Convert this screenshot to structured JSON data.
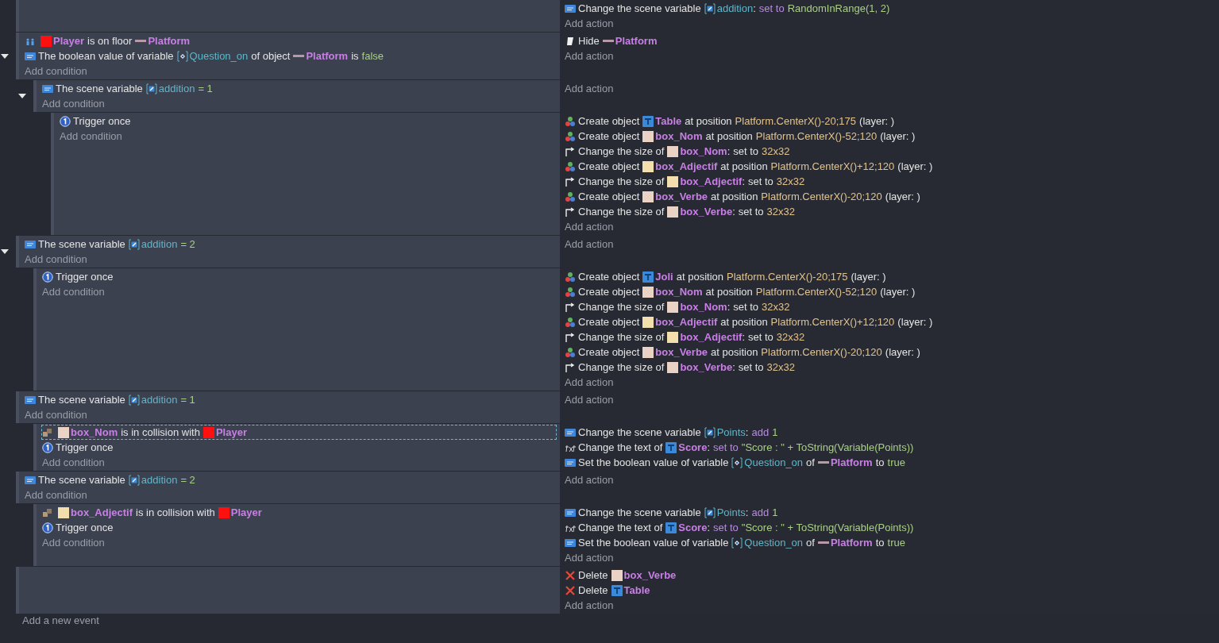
{
  "events": [
    {
      "actions": [
        {
          "kind": "variable",
          "parts": [
            {
              "text": "Change the scene variable",
              "kind": "plain"
            },
            {
              "text": "addition",
              "kind": "scene_variable"
            },
            {
              "text": ":",
              "kind": "suffix"
            },
            {
              "text": "set to",
              "kind": "keyword"
            },
            {
              "text": "RandomInRange(1, 2)",
              "kind": "number"
            }
          ]
        }
      ],
      "add_action": "Add action"
    },
    {
      "expanded": true,
      "conditions": [
        {
          "selected": false,
          "kind": "platformer",
          "parts": [
            {
              "text": "Player",
              "kind": "sprite",
              "color": "#ff1010"
            },
            {
              "text": "is on floor",
              "kind": "plain"
            },
            {
              "text": "Platform",
              "kind": "platform_object"
            }
          ]
        },
        {
          "selected": false,
          "kind": "variable",
          "parts": [
            {
              "text": "The boolean value of variable",
              "kind": "plain"
            },
            {
              "text": "Question_on",
              "kind": "object_variable"
            },
            {
              "text": "of object",
              "kind": "plain"
            },
            {
              "text": "Platform",
              "kind": "platform_object"
            },
            {
              "text": "is",
              "kind": "plain"
            },
            {
              "text": "false",
              "kind": "number"
            }
          ]
        }
      ],
      "add_condition": "Add condition",
      "actions": [
        {
          "kind": "hide",
          "parts": [
            {
              "text": "Hide",
              "kind": "plain"
            },
            {
              "text": "Platform",
              "kind": "platform_object"
            }
          ]
        }
      ],
      "add_action": "Add action",
      "children": [
        {
          "expanded": true,
          "conditions": [
            {
              "selected": false,
              "kind": "variable",
              "parts": [
                {
                  "text": "The scene variable",
                  "kind": "plain"
                },
                {
                  "text": "addition",
                  "kind": "scene_variable"
                },
                {
                  "text": "= 1",
                  "kind": "number"
                }
              ]
            }
          ],
          "add_condition": "Add condition",
          "add_action": "Add action",
          "children": [
            {
              "conditions": [
                {
                  "selected": false,
                  "kind": "trigger",
                  "parts": [
                    {
                      "text": "Trigger once",
                      "kind": "plain"
                    }
                  ]
                }
              ],
              "add_condition": "Add condition",
              "actions": [
                {
                  "kind": "create",
                  "parts": [
                    {
                      "text": "Create object",
                      "kind": "plain"
                    },
                    {
                      "text": "Table",
                      "kind": "text_object"
                    },
                    {
                      "text": "at position",
                      "kind": "plain"
                    },
                    {
                      "text": "Platform.CenterX()-20;175",
                      "kind": "expression"
                    },
                    {
                      "text": "(layer: )",
                      "kind": "plain"
                    }
                  ]
                },
                {
                  "kind": "create",
                  "parts": [
                    {
                      "text": "Create object",
                      "kind": "plain"
                    },
                    {
                      "text": "box_Nom",
                      "kind": "sprite",
                      "color": "#ead2c4"
                    },
                    {
                      "text": "at position",
                      "kind": "plain"
                    },
                    {
                      "text": "Platform.CenterX()-52;120",
                      "kind": "expression"
                    },
                    {
                      "text": "(layer: )",
                      "kind": "plain"
                    }
                  ]
                },
                {
                  "kind": "resize",
                  "parts": [
                    {
                      "text": "Change the size of",
                      "kind": "plain"
                    },
                    {
                      "text": "box_Nom",
                      "kind": "sprite",
                      "color": "#ead2c4"
                    },
                    {
                      "text": ":",
                      "kind": "suffix"
                    },
                    {
                      "text": "set to",
                      "kind": "plain"
                    },
                    {
                      "text": "32x32",
                      "kind": "expression"
                    }
                  ]
                },
                {
                  "kind": "create",
                  "parts": [
                    {
                      "text": "Create object",
                      "kind": "plain"
                    },
                    {
                      "text": "box_Adjectif",
                      "kind": "sprite",
                      "color": "#f3dfae"
                    },
                    {
                      "text": "at position",
                      "kind": "plain"
                    },
                    {
                      "text": "Platform.CenterX()+12;120",
                      "kind": "expression"
                    },
                    {
                      "text": "(layer: )",
                      "kind": "plain"
                    }
                  ]
                },
                {
                  "kind": "resize",
                  "parts": [
                    {
                      "text": "Change the size of",
                      "kind": "plain"
                    },
                    {
                      "text": "box_Adjectif",
                      "kind": "sprite",
                      "color": "#f3dfae"
                    },
                    {
                      "text": ":",
                      "kind": "suffix"
                    },
                    {
                      "text": "set to",
                      "kind": "plain"
                    },
                    {
                      "text": "32x32",
                      "kind": "expression"
                    }
                  ]
                },
                {
                  "kind": "create",
                  "parts": [
                    {
                      "text": "Create object",
                      "kind": "plain"
                    },
                    {
                      "text": "box_Verbe",
                      "kind": "sprite",
                      "color": "#ead2c4"
                    },
                    {
                      "text": "at position",
                      "kind": "plain"
                    },
                    {
                      "text": "Platform.CenterX()-20;120",
                      "kind": "expression"
                    },
                    {
                      "text": "(layer: )",
                      "kind": "plain"
                    }
                  ]
                },
                {
                  "kind": "resize",
                  "parts": [
                    {
                      "text": "Change the size of",
                      "kind": "plain"
                    },
                    {
                      "text": "box_Verbe",
                      "kind": "sprite",
                      "color": "#ead2c4"
                    },
                    {
                      "text": ":",
                      "kind": "suffix"
                    },
                    {
                      "text": "set to",
                      "kind": "plain"
                    },
                    {
                      "text": "32x32",
                      "kind": "expression"
                    }
                  ]
                }
              ],
              "add_action": "Add action"
            }
          ]
        }
      ]
    },
    {
      "expanded": true,
      "conditions": [
        {
          "selected": false,
          "kind": "variable",
          "parts": [
            {
              "text": "The scene variable",
              "kind": "plain"
            },
            {
              "text": "addition",
              "kind": "scene_variable"
            },
            {
              "text": "= 2",
              "kind": "number"
            }
          ]
        }
      ],
      "add_condition": "Add condition",
      "add_action": "Add action",
      "children": [
        {
          "conditions": [
            {
              "selected": false,
              "kind": "trigger",
              "parts": [
                {
                  "text": "Trigger once",
                  "kind": "plain"
                }
              ]
            }
          ],
          "add_condition": "Add condition",
          "actions": [
            {
              "kind": "create",
              "parts": [
                {
                  "text": "Create object",
                  "kind": "plain"
                },
                {
                  "text": "Joli",
                  "kind": "text_object"
                },
                {
                  "text": "at position",
                  "kind": "plain"
                },
                {
                  "text": "Platform.CenterX()-20;175",
                  "kind": "expression"
                },
                {
                  "text": "(layer: )",
                  "kind": "plain"
                }
              ]
            },
            {
              "kind": "create",
              "parts": [
                {
                  "text": "Create object",
                  "kind": "plain"
                },
                {
                  "text": "box_Nom",
                  "kind": "sprite",
                  "color": "#ead2c4"
                },
                {
                  "text": "at position",
                  "kind": "plain"
                },
                {
                  "text": "Platform.CenterX()-52;120",
                  "kind": "expression"
                },
                {
                  "text": "(layer: )",
                  "kind": "plain"
                }
              ]
            },
            {
              "kind": "resize",
              "parts": [
                {
                  "text": "Change the size of",
                  "kind": "plain"
                },
                {
                  "text": "box_Nom",
                  "kind": "sprite",
                  "color": "#ead2c4"
                },
                {
                  "text": ":",
                  "kind": "suffix"
                },
                {
                  "text": "set to",
                  "kind": "plain"
                },
                {
                  "text": "32x32",
                  "kind": "expression"
                }
              ]
            },
            {
              "kind": "create",
              "parts": [
                {
                  "text": "Create object",
                  "kind": "plain"
                },
                {
                  "text": "box_Adjectif",
                  "kind": "sprite",
                  "color": "#f3dfae"
                },
                {
                  "text": "at position",
                  "kind": "plain"
                },
                {
                  "text": "Platform.CenterX()+12;120",
                  "kind": "expression"
                },
                {
                  "text": "(layer: )",
                  "kind": "plain"
                }
              ]
            },
            {
              "kind": "resize",
              "parts": [
                {
                  "text": "Change the size of",
                  "kind": "plain"
                },
                {
                  "text": "box_Adjectif",
                  "kind": "sprite",
                  "color": "#f3dfae"
                },
                {
                  "text": ":",
                  "kind": "suffix"
                },
                {
                  "text": "set to",
                  "kind": "plain"
                },
                {
                  "text": "32x32",
                  "kind": "expression"
                }
              ]
            },
            {
              "kind": "create",
              "parts": [
                {
                  "text": "Create object",
                  "kind": "plain"
                },
                {
                  "text": "box_Verbe",
                  "kind": "sprite",
                  "color": "#ead2c4"
                },
                {
                  "text": "at position",
                  "kind": "plain"
                },
                {
                  "text": "Platform.CenterX()-20;120",
                  "kind": "expression"
                },
                {
                  "text": "(layer: )",
                  "kind": "plain"
                }
              ]
            },
            {
              "kind": "resize",
              "parts": [
                {
                  "text": "Change the size of",
                  "kind": "plain"
                },
                {
                  "text": "box_Verbe",
                  "kind": "sprite",
                  "color": "#ead2c4"
                },
                {
                  "text": ":",
                  "kind": "suffix"
                },
                {
                  "text": "set to",
                  "kind": "plain"
                },
                {
                  "text": "32x32",
                  "kind": "expression"
                }
              ]
            }
          ],
          "add_action": "Add action"
        }
      ]
    },
    {
      "conditions": [
        {
          "selected": false,
          "kind": "variable",
          "parts": [
            {
              "text": "The scene variable",
              "kind": "plain"
            },
            {
              "text": "addition",
              "kind": "scene_variable"
            },
            {
              "text": "= 1",
              "kind": "number"
            }
          ]
        }
      ],
      "add_condition": "Add condition",
      "add_action": "Add action",
      "children": [
        {
          "conditions": [
            {
              "selected": true,
              "kind": "collision",
              "parts": [
                {
                  "text": "box_Nom",
                  "kind": "sprite",
                  "color": "#ead2c4"
                },
                {
                  "text": "is in collision with",
                  "kind": "plain"
                },
                {
                  "text": "Player",
                  "kind": "sprite",
                  "color": "#ff1010"
                }
              ]
            },
            {
              "selected": false,
              "kind": "trigger",
              "parts": [
                {
                  "text": "Trigger once",
                  "kind": "plain"
                }
              ]
            }
          ],
          "add_condition": "Add condition",
          "actions": [
            {
              "kind": "variable",
              "parts": [
                {
                  "text": "Change the scene variable",
                  "kind": "plain"
                },
                {
                  "text": "Points",
                  "kind": "scene_variable"
                },
                {
                  "text": ":",
                  "kind": "suffix"
                },
                {
                  "text": "add",
                  "kind": "keyword"
                },
                {
                  "text": "1",
                  "kind": "number"
                }
              ]
            },
            {
              "kind": "text",
              "parts": [
                {
                  "text": "Change the text of",
                  "kind": "plain"
                },
                {
                  "text": "Score",
                  "kind": "text_object"
                },
                {
                  "text": ":",
                  "kind": "suffix"
                },
                {
                  "text": "set to",
                  "kind": "keyword"
                },
                {
                  "text": "\"Score : \" + ToString(Variable(Points))",
                  "kind": "number"
                }
              ]
            },
            {
              "kind": "variable",
              "parts": [
                {
                  "text": "Set the boolean value of variable",
                  "kind": "plain"
                },
                {
                  "text": "Question_on",
                  "kind": "object_variable"
                },
                {
                  "text": "of",
                  "kind": "plain"
                },
                {
                  "text": "Platform",
                  "kind": "platform_object"
                },
                {
                  "text": "to",
                  "kind": "plain"
                },
                {
                  "text": "true",
                  "kind": "number"
                }
              ]
            }
          ]
        }
      ]
    },
    {
      "conditions": [
        {
          "selected": false,
          "kind": "variable",
          "parts": [
            {
              "text": "The scene variable",
              "kind": "plain"
            },
            {
              "text": "addition",
              "kind": "scene_variable"
            },
            {
              "text": "= 2",
              "kind": "number"
            }
          ]
        }
      ],
      "add_condition": "Add condition",
      "add_action": "Add action",
      "children": [
        {
          "conditions": [
            {
              "selected": false,
              "kind": "collision",
              "parts": [
                {
                  "text": "box_Adjectif",
                  "kind": "sprite",
                  "color": "#f3dfae"
                },
                {
                  "text": "is in collision with",
                  "kind": "plain"
                },
                {
                  "text": "Player",
                  "kind": "sprite",
                  "color": "#ff1010"
                }
              ]
            },
            {
              "selected": false,
              "kind": "trigger",
              "parts": [
                {
                  "text": "Trigger once",
                  "kind": "plain"
                }
              ]
            }
          ],
          "add_condition": "Add condition",
          "actions": [
            {
              "kind": "variable",
              "parts": [
                {
                  "text": "Change the scene variable",
                  "kind": "plain"
                },
                {
                  "text": "Points",
                  "kind": "scene_variable"
                },
                {
                  "text": ":",
                  "kind": "suffix"
                },
                {
                  "text": "add",
                  "kind": "keyword"
                },
                {
                  "text": "1",
                  "kind": "number"
                }
              ]
            },
            {
              "kind": "text",
              "parts": [
                {
                  "text": "Change the text of",
                  "kind": "plain"
                },
                {
                  "text": "Score",
                  "kind": "text_object"
                },
                {
                  "text": ":",
                  "kind": "suffix"
                },
                {
                  "text": "set to",
                  "kind": "keyword"
                },
                {
                  "text": "\"Score : \" + ToString(Variable(Points))",
                  "kind": "number"
                }
              ]
            },
            {
              "kind": "variable",
              "parts": [
                {
                  "text": "Set the boolean value of variable",
                  "kind": "plain"
                },
                {
                  "text": "Question_on",
                  "kind": "object_variable"
                },
                {
                  "text": "of",
                  "kind": "plain"
                },
                {
                  "text": "Platform",
                  "kind": "platform_object"
                },
                {
                  "text": "to",
                  "kind": "plain"
                },
                {
                  "text": "true",
                  "kind": "number"
                }
              ]
            }
          ],
          "add_action": "Add action"
        }
      ]
    },
    {
      "actions": [
        {
          "kind": "delete",
          "parts": [
            {
              "text": "Delete",
              "kind": "plain"
            },
            {
              "text": "box_Verbe",
              "kind": "sprite",
              "color": "#ead2c4"
            }
          ]
        },
        {
          "kind": "delete",
          "parts": [
            {
              "text": "Delete",
              "kind": "plain"
            },
            {
              "text": "Table",
              "kind": "text_object"
            }
          ]
        }
      ],
      "add_action": "Add action"
    }
  ],
  "add_event": "Add a new event"
}
